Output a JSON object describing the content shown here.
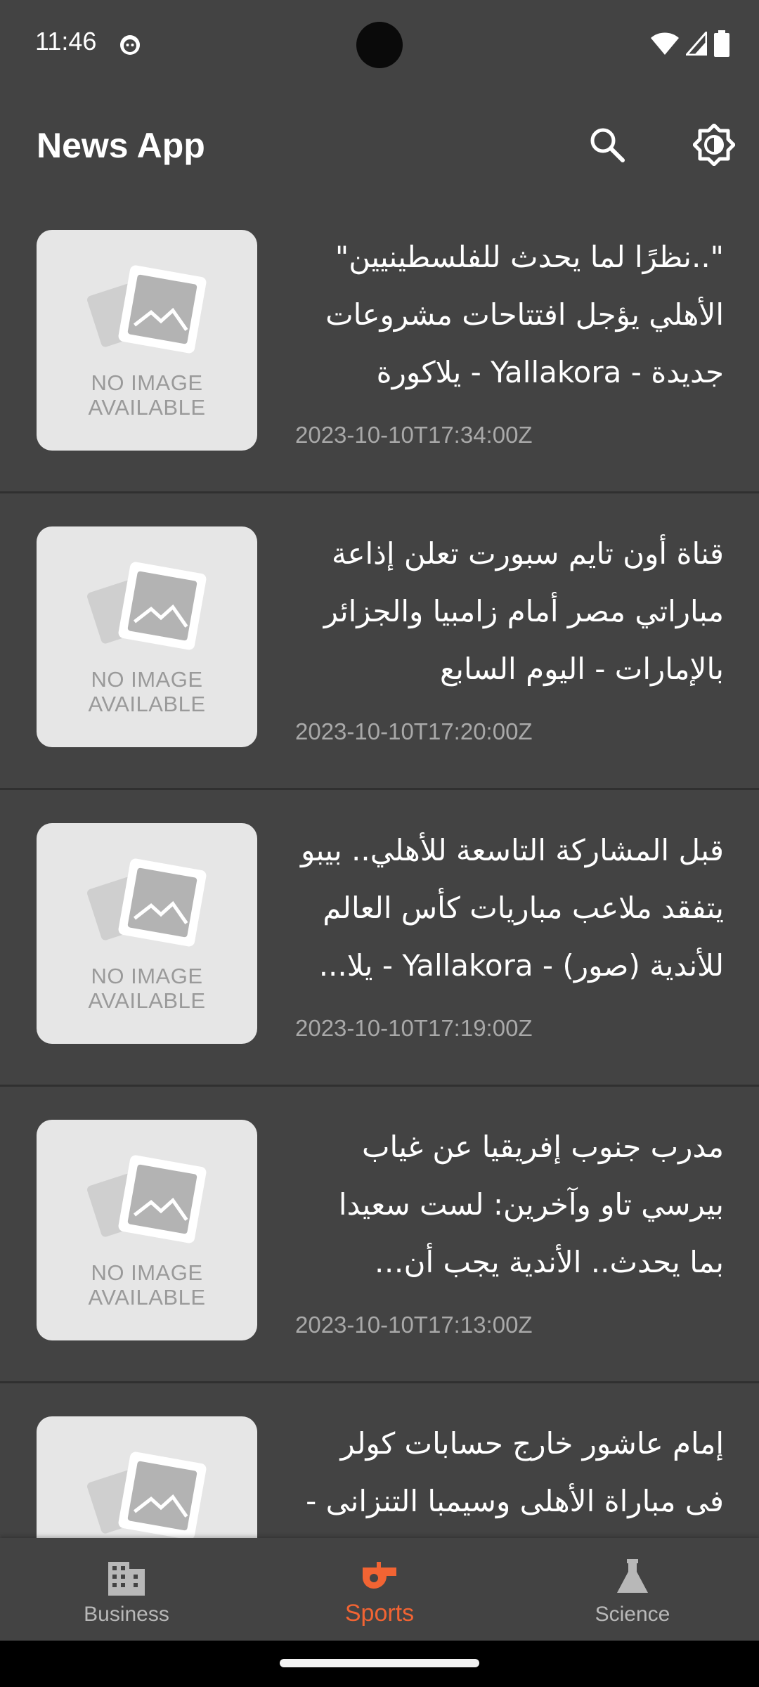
{
  "status_bar": {
    "time": "11:46"
  },
  "app_bar": {
    "title": "News App",
    "icons": [
      "search-icon",
      "brightness-icon"
    ]
  },
  "thumbnail_placeholder": {
    "line1": "NO IMAGE",
    "line2": "AVAILABLE"
  },
  "news": [
    {
      "title": "\"..نظرًا لما يحدث للفلسطينيين\" الأهلي يؤجل افتتاحات مشروعات جديدة - Yallakora - يلاكورة",
      "date": "2023-10-10T17:34:00Z"
    },
    {
      "title": "قناة أون تايم سبورت تعلن إذاعة مباراتي مصر أمام زامبيا والجزائر بالإمارات - اليوم السابع",
      "date": "2023-10-10T17:20:00Z"
    },
    {
      "title": "قبل المشاركة التاسعة للأهلي.. بيبو يتفقد ملاعب مباريات كأس العالم للأندية (صور) - Yallakora - يلا...",
      "date": "2023-10-10T17:19:00Z"
    },
    {
      "title": "مدرب جنوب إفريقيا عن غياب بيرسي تاو وآخرين: لست سعيدا بما يحدث.. الأندية يجب أن تتعاون...",
      "date": "2023-10-10T17:13:00Z"
    },
    {
      "title": "إمام عاشور خارج حسابات كولر فى مباراة الأهلى وسيمبا التنزانى -",
      "date": ""
    }
  ],
  "bottom_nav": {
    "items": [
      {
        "label": "Business",
        "icon": "building-icon",
        "active": false
      },
      {
        "label": "Sports",
        "icon": "whistle-icon",
        "active": true
      },
      {
        "label": "Science",
        "icon": "flask-icon",
        "active": false
      }
    ]
  },
  "colors": {
    "background": "#434343",
    "accent": "#f26433",
    "thumbnail_bg": "#e6e6e6"
  }
}
